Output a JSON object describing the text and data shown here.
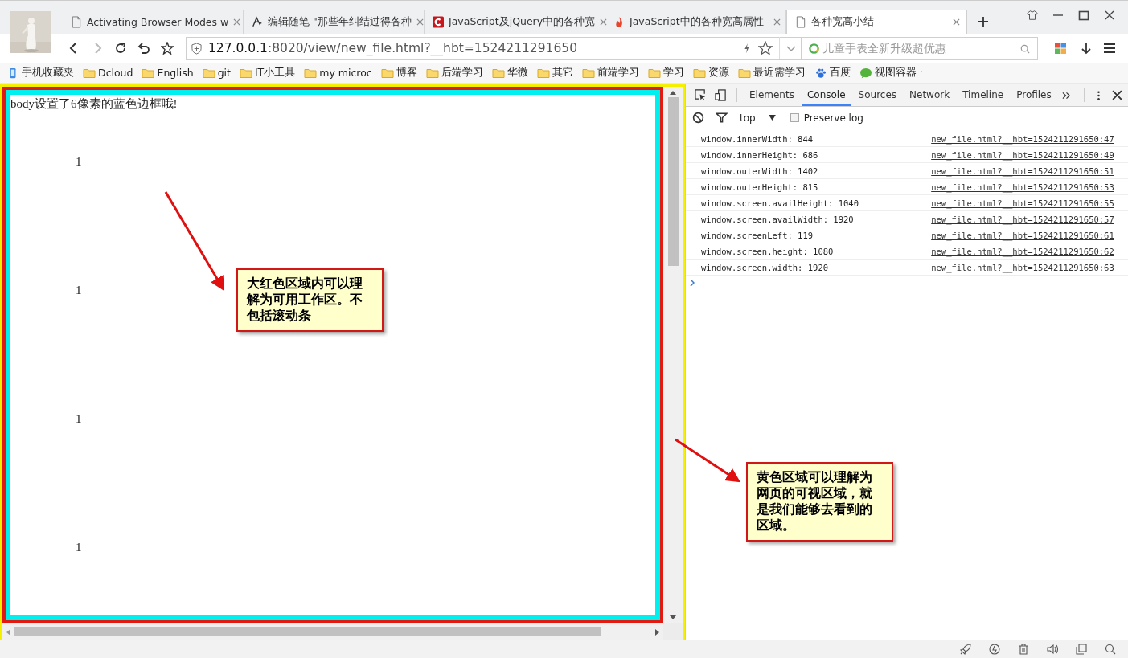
{
  "tabs": [
    {
      "title": "Activating Browser Modes w",
      "kind": "page",
      "selected": false
    },
    {
      "title": "编辑随笔 \"那些年纠结过得各种",
      "kind": "pen",
      "selected": false
    },
    {
      "title": "JavaScript及jQuery中的各种宽",
      "kind": "logo",
      "selected": false
    },
    {
      "title": "JavaScript中的各种宽高属性_",
      "kind": "flame",
      "selected": false
    },
    {
      "title": "各种宽高小结",
      "kind": "page",
      "selected": true
    }
  ],
  "address": {
    "host": "127.0.0.1",
    "path": ":8020/view/new_file.html?__hbt=1524211291650"
  },
  "search": {
    "placeholder": "儿童手表全新升级超优惠"
  },
  "bookmarks": [
    {
      "label": "手机收藏夹",
      "kind": "phone"
    },
    {
      "label": "Dcloud",
      "kind": "folder"
    },
    {
      "label": "English",
      "kind": "folder"
    },
    {
      "label": "git",
      "kind": "folder"
    },
    {
      "label": "IT小工具",
      "kind": "folder"
    },
    {
      "label": "my microc",
      "kind": "folder"
    },
    {
      "label": "博客",
      "kind": "folder"
    },
    {
      "label": "后端学习",
      "kind": "folder"
    },
    {
      "label": "华微",
      "kind": "folder"
    },
    {
      "label": "其它",
      "kind": "folder"
    },
    {
      "label": "前端学习",
      "kind": "folder"
    },
    {
      "label": "学习",
      "kind": "folder"
    },
    {
      "label": "资源",
      "kind": "folder"
    },
    {
      "label": "最近需学习",
      "kind": "folder"
    },
    {
      "label": "百度",
      "kind": "paw"
    },
    {
      "label": "视图容器 ·",
      "kind": "chat"
    }
  ],
  "page": {
    "heading": "body设置了6像素的蓝色边框哦!",
    "numbers": [
      "1",
      "1",
      "1",
      "1"
    ]
  },
  "annotations": [
    {
      "text": "大红色区域内可以理解为可用工作区。不包括滚动条"
    },
    {
      "text": "黄色区域可以理解为网页的可视区域，就是我们能够去看到的区域。"
    }
  ],
  "devtools": {
    "tabs": [
      {
        "label": "Elements",
        "selected": false
      },
      {
        "label": "Console",
        "selected": true
      },
      {
        "label": "Sources",
        "selected": false
      },
      {
        "label": "Network",
        "selected": false
      },
      {
        "label": "Timeline",
        "selected": false
      },
      {
        "label": "Profiles",
        "selected": false
      }
    ],
    "context": "top",
    "preserve_log": {
      "label": "Preserve log",
      "checked": false
    },
    "logs": [
      {
        "message": "window.innerWidth: 844",
        "source": "new_file.html?__hbt=1524211291650:47"
      },
      {
        "message": "window.innerHeight: 686",
        "source": "new_file.html?__hbt=1524211291650:49"
      },
      {
        "message": "window.outerWidth: 1402",
        "source": "new_file.html?__hbt=1524211291650:51"
      },
      {
        "message": "window.outerHeight: 815",
        "source": "new_file.html?__hbt=1524211291650:53"
      },
      {
        "message": "window.screen.availHeight: 1040",
        "source": "new_file.html?__hbt=1524211291650:55"
      },
      {
        "message": "window.screen.availWidth: 1920",
        "source": "new_file.html?__hbt=1524211291650:57"
      },
      {
        "message": "window.screenLeft: 119",
        "source": "new_file.html?__hbt=1524211291650:61"
      },
      {
        "message": "window.screen.height: 1080",
        "source": "new_file.html?__hbt=1524211291650:62"
      },
      {
        "message": "window.screen.width: 1920",
        "source": "new_file.html?__hbt=1524211291650:63"
      }
    ]
  }
}
